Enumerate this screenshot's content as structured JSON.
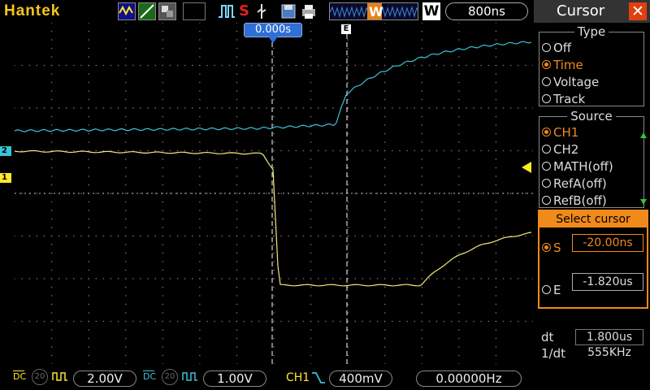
{
  "header": {
    "brand": "Hantek",
    "timebase": "800ns",
    "w_label": "W",
    "trigger_letter": "W",
    "stop_letter": "S"
  },
  "screen": {
    "time_marker": "0.000s",
    "cursor_e_label": "E",
    "ch1_marker": "1",
    "ch2_marker": "2",
    "colors": {
      "ch1": "#f2ea7a",
      "ch2": "#3ac2d8",
      "grid": "#7a7a7a",
      "accent": "#f08a1a"
    }
  },
  "panel": {
    "title": "Cursor",
    "close_icon": "close-icon",
    "type_group": {
      "title": "Type",
      "options": [
        "Off",
        "Time",
        "Voltage",
        "Track"
      ],
      "selected": "Time"
    },
    "source_group": {
      "title": "Source",
      "options": [
        "CH1",
        "CH2",
        "MATH(off)",
        "RefA(off)",
        "RefB(off)"
      ],
      "selected": "CH1"
    },
    "select_cursor": {
      "title": "Select cursor",
      "s_label": "S",
      "s_value": "-20.00ns",
      "e_label": "E",
      "e_value": "-1.820us",
      "selected": "S"
    },
    "measure": {
      "dt_label": "dt",
      "dt_value": "1.800us",
      "inv_dt_label": "1/dt",
      "inv_dt_value": "555KHz"
    }
  },
  "footer": {
    "ch1_coupling": "DC",
    "ch1_bw": "20",
    "ch1_volts": "2.00V",
    "ch2_coupling": "DC",
    "ch2_bw": "20",
    "ch2_volts": "1.00V",
    "trigger_source": "CH1",
    "trigger_level": "400mV",
    "frequency": "0.00000Hz"
  }
}
